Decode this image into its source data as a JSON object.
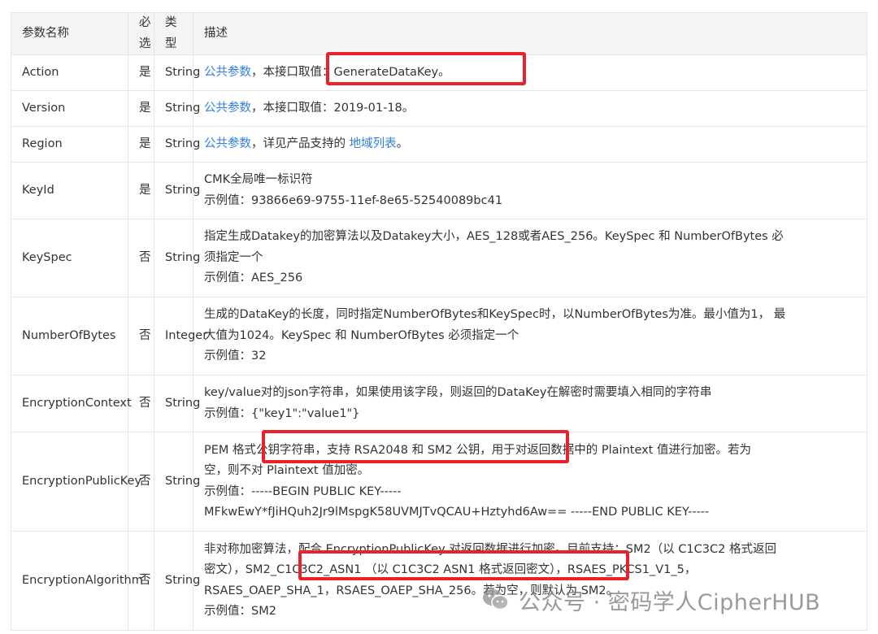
{
  "headers": {
    "name": "参数名称",
    "required": "必选",
    "type": "类型",
    "desc": "描述"
  },
  "rows": [
    {
      "name": "Action",
      "required": "是",
      "type": "String",
      "h": 44,
      "lines": [
        [
          {
            "t": "公共参数",
            "link": true
          },
          {
            "t": "，"
          },
          {
            "t": "本接口取值：GenerateDataKey。"
          }
        ]
      ]
    },
    {
      "name": "Version",
      "required": "是",
      "type": "String",
      "h": 44,
      "lines": [
        [
          {
            "t": "公共参数",
            "link": true
          },
          {
            "t": "，本接口取值：2019-01-18。"
          }
        ]
      ]
    },
    {
      "name": "Region",
      "required": "是",
      "type": "String",
      "h": 44,
      "lines": [
        [
          {
            "t": "公共参数",
            "link": true
          },
          {
            "t": "，详见产品支持的 "
          },
          {
            "t": "地域列表",
            "link": true
          },
          {
            "t": "。"
          }
        ]
      ]
    },
    {
      "name": "KeyId",
      "required": "是",
      "type": "String",
      "h": 70,
      "lines": [
        [
          {
            "t": "CMK全局唯一标识符"
          }
        ],
        [
          {
            "t": "示例值：93866e69-9755-11ef-8e65-52540089bc41"
          }
        ]
      ]
    },
    {
      "name": "KeySpec",
      "required": "否",
      "type": "String",
      "h": 96,
      "lines": [
        [
          {
            "t": "指定生成Datakey的加密算法以及Datakey大小，AES_128或者AES_256。KeySpec 和 NumberOfBytes 必"
          }
        ],
        [
          {
            "t": "须指定一个"
          }
        ],
        [
          {
            "t": "示例值：AES_256"
          }
        ]
      ]
    },
    {
      "name": "NumberOfBytes",
      "required": "否",
      "type": "Integer",
      "h": 96,
      "lines": [
        [
          {
            "t": "生成的DataKey的长度，同时指定NumberOfBytes和KeySpec时，以NumberOfBytes为准。最小值为1，  最"
          }
        ],
        [
          {
            "t": "大值为1024。KeySpec 和 NumberOfBytes 必须指定一个"
          }
        ],
        [
          {
            "t": "示例值：32"
          }
        ]
      ]
    },
    {
      "name": "EncryptionContext",
      "required": "否",
      "type": "String",
      "h": 70,
      "lines": [
        [
          {
            "t": "key/value对的json字符串，如果使用该字段，则返回的DataKey在解密时需要填入相同的字符串"
          }
        ],
        [
          {
            "t": "示例值：{\"key1\":\"value1\"}"
          }
        ]
      ]
    },
    {
      "name": "EncryptionPublicKey",
      "required": "否",
      "type": "String",
      "h": 122,
      "lines": [
        [
          {
            "t": "PEM 格式公钥字符串，支持 RSA2048 和 SM2 公钥，用于对返回数据中的 Plaintext 值进行加密。若为"
          }
        ],
        [
          {
            "t": "空，则不对 Plaintext 值加密。"
          }
        ],
        [
          {
            "t": "示例值：-----BEGIN PUBLIC KEY-----"
          }
        ],
        [
          {
            "t": "MFkwEwY*fJiHQuh2Jr9lMspgK58UVMJTvQCAU+Hztyhd6Aw== -----END PUBLIC KEY-----"
          }
        ]
      ]
    },
    {
      "name": "EncryptionAlgorithm",
      "required": "否",
      "type": "String",
      "h": 122,
      "lines": [
        [
          {
            "t": "非对称加密算法，配合 EncryptionPublicKey 对返回数据进行加密。目前支持：SM2（以 C1C3C2 格式返回"
          }
        ],
        [
          {
            "t": "密文），SM2_C1C3C2_ASN1 （以 C1C3C2 ASN1 格式返回密文），RSAES_PKCS1_V1_5，"
          }
        ],
        [
          {
            "t": "RSAES_OAEP_SHA_1，RSAES_OAEP_SHA_256。若为空，则默认为 SM2。"
          }
        ],
        [
          {
            "t": "示例值：SM2"
          }
        ]
      ]
    }
  ],
  "watermark": {
    "text": "公众号 · 密码学人CipherHUB",
    "icon": "wechat-icon"
  },
  "colors": {
    "link": "#2f7fe8",
    "highlight": "#e8222a",
    "header_bg": "#f3f4f6",
    "border": "#e6e6e6"
  }
}
